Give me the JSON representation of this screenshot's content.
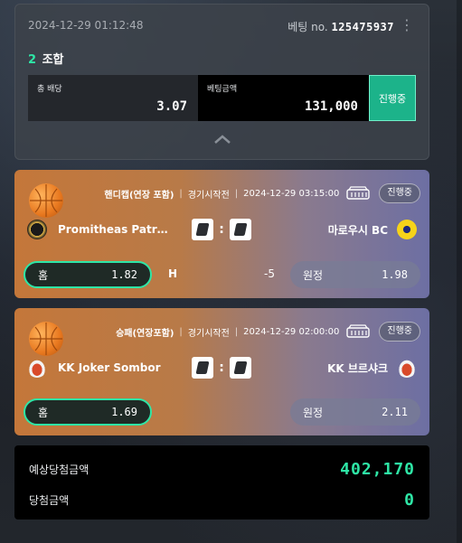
{
  "summary": {
    "datetime": "2024-12-29 01:12:48",
    "bet_no_label": "베팅 no.",
    "bet_no": "125475937",
    "combo_count": "2",
    "combo_label": "조합",
    "total_odds_label": "총 배당",
    "total_odds": "3.07",
    "bet_amount_label": "베팅금액",
    "bet_amount": "131,000",
    "status": "진행중"
  },
  "matches": [
    {
      "market": "핸디캡(연장 포함)",
      "state": "경기시작전",
      "time": "2024-12-29 03:15:00",
      "status": "진행중",
      "home": "Promitheas Patra...",
      "away": "마로우시 BC",
      "home_score": "0",
      "away_score": "0",
      "pick_label": "홈",
      "pick_odds": "1.82",
      "handicap_label": "H",
      "handicap_line": "-5",
      "other_label": "원정",
      "other_odds": "1.98"
    },
    {
      "market": "승패(연장포함)",
      "state": "경기시작전",
      "time": "2024-12-29 02:00:00",
      "status": "진행중",
      "home": "KK Joker Sombor",
      "away": "KK 브르샤크",
      "home_score": "0",
      "away_score": "0",
      "pick_label": "홈",
      "pick_odds": "1.69",
      "other_label": "원정",
      "other_odds": "2.11"
    }
  ],
  "totals": {
    "expected_label": "예상당첨금액",
    "expected_value": "402,170",
    "won_label": "당첨금액",
    "won_value": "0"
  },
  "colors": {
    "accent": "#2ee6a6",
    "status_button": "#1cb38a"
  }
}
